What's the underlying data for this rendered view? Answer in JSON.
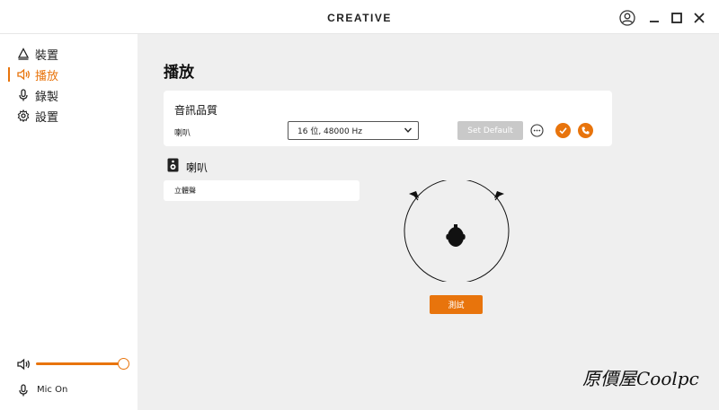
{
  "titlebar": {
    "brand": "CREATIVE",
    "icons": [
      "user-circle-icon",
      "minimize-icon",
      "maximize-icon",
      "close-icon"
    ]
  },
  "sidebar": {
    "items": [
      {
        "label": "裝置",
        "icon": "device-icon",
        "active": false
      },
      {
        "label": "播放",
        "icon": "speaker-icon",
        "active": true
      },
      {
        "label": "錄製",
        "icon": "microphone-icon",
        "active": false
      },
      {
        "label": "設置",
        "icon": "gear-icon",
        "active": false
      }
    ],
    "volume_level": 0.96,
    "mic_label": "Mic On"
  },
  "main": {
    "title": "播放",
    "quality": {
      "title": "音訊品質",
      "device_label": "喇叭",
      "format_value": "16 位, 48000 Hz",
      "set_default_label": "Set Default"
    },
    "speaker": {
      "title": "喇叭",
      "mode_value": "立體聲"
    },
    "test_label": "測試"
  },
  "watermark": "原價屋Coolpc",
  "colors": {
    "accent": "#e8740c",
    "background": "#efefef",
    "disabled": "#c9c9c9"
  }
}
